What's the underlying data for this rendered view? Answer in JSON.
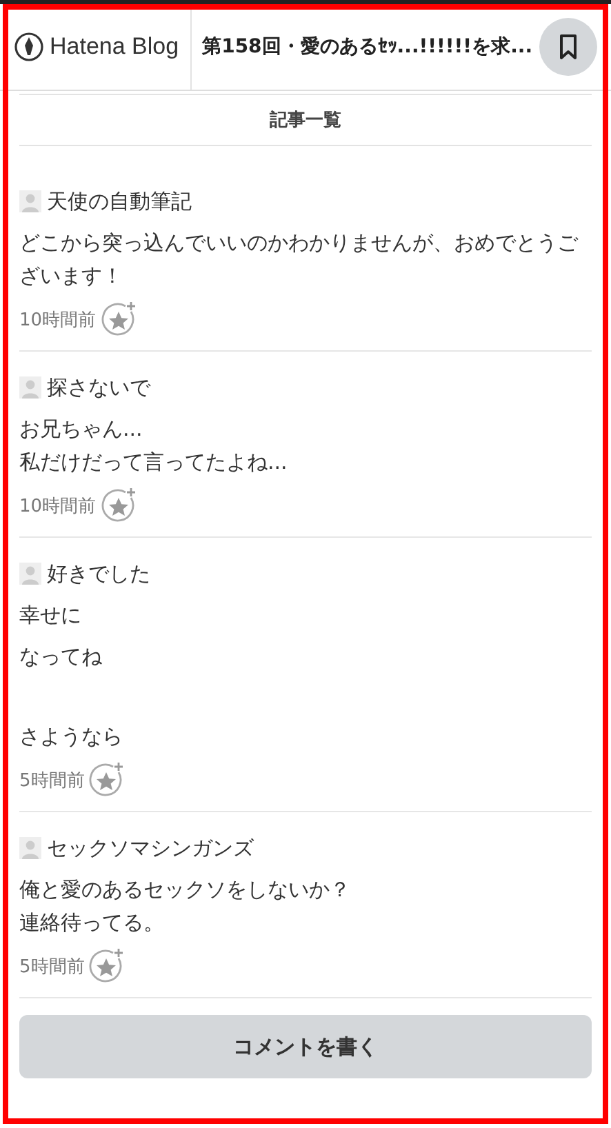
{
  "header": {
    "logo_text": "Hatena Blog",
    "title": "第158回・愛のあるｾｯ...!!!!!!を求..."
  },
  "section_title": "記事一覧",
  "comments": [
    {
      "author": "天使の自動筆記",
      "paragraphs": [
        {
          "lines": [
            "どこから突っ込んでいいのかわかりませんが、おめでとうございます！"
          ],
          "spaced": false
        }
      ],
      "time": "10時間前"
    },
    {
      "author": "探さないで",
      "paragraphs": [
        {
          "lines": [
            "お兄ちゃん...",
            "私だけだって言ってたよね..."
          ],
          "spaced": false
        }
      ],
      "time": "10時間前"
    },
    {
      "author": "好きでした",
      "paragraphs": [
        {
          "lines": [
            "幸せに"
          ],
          "spaced": false
        },
        {
          "lines": [
            "なってね"
          ],
          "spaced": false
        },
        {
          "lines": [
            "さようなら"
          ],
          "spaced": true
        }
      ],
      "time": "5時間前"
    },
    {
      "author": "セックソマシンガンズ",
      "paragraphs": [
        {
          "lines": [
            "俺と愛のあるセックソをしないか？",
            "連絡待ってる。"
          ],
          "spaced": false
        }
      ],
      "time": "5時間前"
    }
  ],
  "comment_button": "コメントを書く"
}
